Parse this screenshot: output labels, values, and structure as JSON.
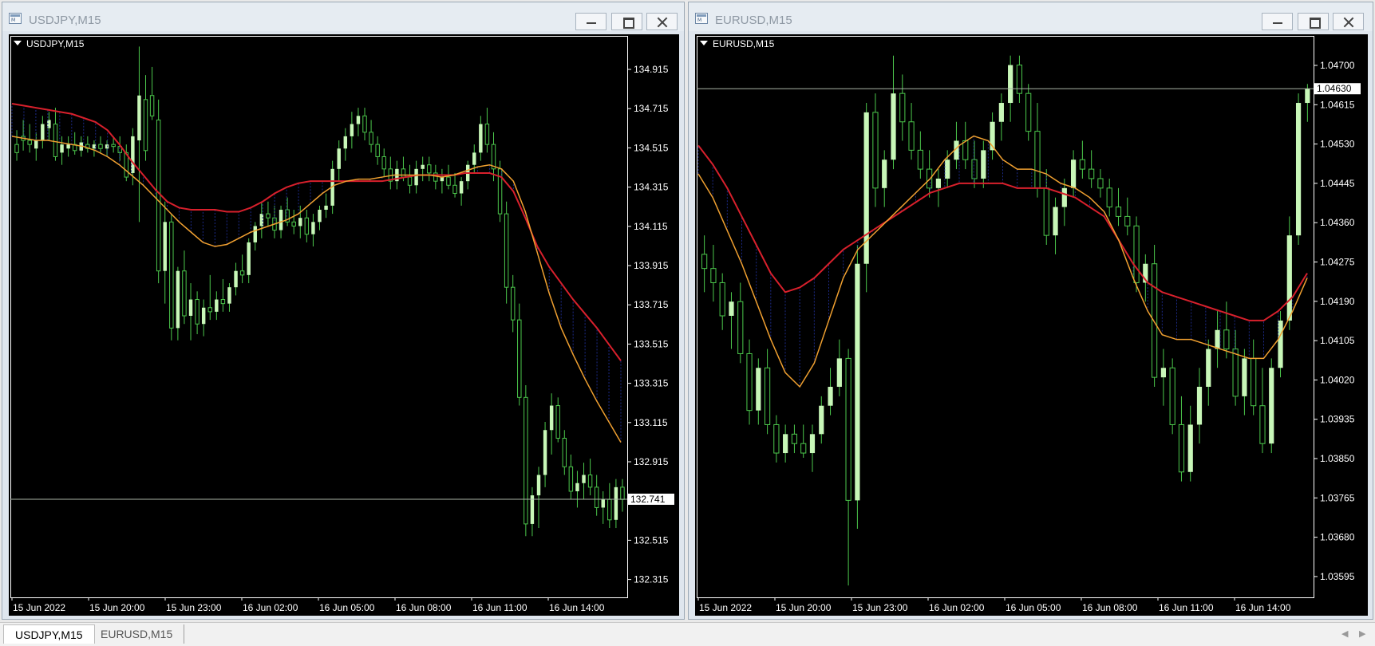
{
  "windows": [
    {
      "title": "USDJPY,M15",
      "symbol_label": "USDJPY,M15",
      "price_labels": [
        "134.915",
        "134.715",
        "134.515",
        "134.315",
        "134.115",
        "133.915",
        "133.715",
        "133.515",
        "133.315",
        "133.115",
        "132.915",
        "132.715",
        "132.515",
        "132.315"
      ],
      "current_price": "132.741",
      "time_labels": [
        "15 Jun 2022",
        "15 Jun 20:00",
        "15 Jun 23:00",
        "16 Jun 02:00",
        "16 Jun 05:00",
        "16 Jun 08:00",
        "16 Jun 11:00",
        "16 Jun 14:00"
      ],
      "price_min": 132.26,
      "price_max": 135.02,
      "line_price": 132.741,
      "candles": [
        [
          134.48,
          134.55,
          134.4,
          134.44
        ],
        [
          134.52,
          134.6,
          134.45,
          134.5
        ],
        [
          134.5,
          134.58,
          134.44,
          134.48
        ],
        [
          134.46,
          134.54,
          134.4,
          134.5
        ],
        [
          134.5,
          134.62,
          134.46,
          134.58
        ],
        [
          134.56,
          134.64,
          134.5,
          134.6
        ],
        [
          134.58,
          134.66,
          134.4,
          134.42
        ],
        [
          134.44,
          134.52,
          134.38,
          134.48
        ],
        [
          134.46,
          134.52,
          134.42,
          134.48
        ],
        [
          134.48,
          134.54,
          134.43,
          134.45
        ],
        [
          134.45,
          134.52,
          134.42,
          134.49
        ],
        [
          134.48,
          134.52,
          134.44,
          134.46
        ],
        [
          134.46,
          134.5,
          134.42,
          134.48
        ],
        [
          134.48,
          134.52,
          134.44,
          134.46
        ],
        [
          134.46,
          134.5,
          134.42,
          134.48
        ],
        [
          134.48,
          134.52,
          134.44,
          134.47
        ],
        [
          134.47,
          134.52,
          134.4,
          134.44
        ],
        [
          134.44,
          134.48,
          134.3,
          134.32
        ],
        [
          134.34,
          134.56,
          134.28,
          134.52
        ],
        [
          134.5,
          134.96,
          134.1,
          134.72
        ],
        [
          134.7,
          134.82,
          134.4,
          134.45
        ],
        [
          134.72,
          134.86,
          134.6,
          134.62
        ],
        [
          134.6,
          134.7,
          133.8,
          133.86
        ],
        [
          133.86,
          134.2,
          133.7,
          134.1
        ],
        [
          134.1,
          134.14,
          133.52,
          133.58
        ],
        [
          133.58,
          133.88,
          133.52,
          133.86
        ],
        [
          133.86,
          133.96,
          133.6,
          133.64
        ],
        [
          133.64,
          133.8,
          133.52,
          133.72
        ],
        [
          133.72,
          133.76,
          133.55,
          133.6
        ],
        [
          133.6,
          133.72,
          133.54,
          133.68
        ],
        [
          133.68,
          133.84,
          133.62,
          133.66
        ],
        [
          133.66,
          133.76,
          133.62,
          133.72
        ],
        [
          133.72,
          133.82,
          133.66,
          133.7
        ],
        [
          133.7,
          133.8,
          133.66,
          133.78
        ],
        [
          133.78,
          133.9,
          133.74,
          133.86
        ],
        [
          133.86,
          133.94,
          133.8,
          133.84
        ],
        [
          133.84,
          134.02,
          133.8,
          134.0
        ],
        [
          134.0,
          134.1,
          133.96,
          134.08
        ],
        [
          134.08,
          134.2,
          134.02,
          134.14
        ],
        [
          134.14,
          134.2,
          134.08,
          134.12
        ],
        [
          134.12,
          134.18,
          134.02,
          134.06
        ],
        [
          134.06,
          134.18,
          134.02,
          134.16
        ],
        [
          134.16,
          134.22,
          134.08,
          134.1
        ],
        [
          134.1,
          134.16,
          134.04,
          134.08
        ],
        [
          134.08,
          134.18,
          134.02,
          134.12
        ],
        [
          134.12,
          134.16,
          134.0,
          134.04
        ],
        [
          134.04,
          134.14,
          133.98,
          134.1
        ],
        [
          134.1,
          134.18,
          134.06,
          134.16
        ],
        [
          134.16,
          134.24,
          134.12,
          134.18
        ],
        [
          134.18,
          134.4,
          134.14,
          134.36
        ],
        [
          134.36,
          134.5,
          134.3,
          134.46
        ],
        [
          134.46,
          134.56,
          134.4,
          134.52
        ],
        [
          134.52,
          134.64,
          134.46,
          134.58
        ],
        [
          134.58,
          134.66,
          134.52,
          134.62
        ],
        [
          134.62,
          134.66,
          134.5,
          134.54
        ],
        [
          134.54,
          134.6,
          134.44,
          134.48
        ],
        [
          134.48,
          134.52,
          134.38,
          134.42
        ],
        [
          134.42,
          134.46,
          134.32,
          134.36
        ],
        [
          134.36,
          134.42,
          134.26,
          134.3
        ],
        [
          134.3,
          134.4,
          134.26,
          134.36
        ],
        [
          134.36,
          134.42,
          134.3,
          134.32
        ],
        [
          134.32,
          134.38,
          134.24,
          134.28
        ],
        [
          134.28,
          134.4,
          134.24,
          134.36
        ],
        [
          134.36,
          134.42,
          134.3,
          134.38
        ],
        [
          134.38,
          134.42,
          134.3,
          134.34
        ],
        [
          134.34,
          134.38,
          134.26,
          134.3
        ],
        [
          134.3,
          134.36,
          134.24,
          134.32
        ],
        [
          134.32,
          134.38,
          134.26,
          134.28
        ],
        [
          134.28,
          134.34,
          134.22,
          134.24
        ],
        [
          134.24,
          134.32,
          134.18,
          134.3
        ],
        [
          134.3,
          134.4,
          134.26,
          134.38
        ],
        [
          134.38,
          134.48,
          134.34,
          134.44
        ],
        [
          134.44,
          134.62,
          134.4,
          134.58
        ],
        [
          134.58,
          134.66,
          134.44,
          134.48
        ],
        [
          134.48,
          134.54,
          134.3,
          134.36
        ],
        [
          134.36,
          134.4,
          134.1,
          134.14
        ],
        [
          134.14,
          134.2,
          133.7,
          133.78
        ],
        [
          133.78,
          133.84,
          133.56,
          133.62
        ],
        [
          133.62,
          133.7,
          133.2,
          133.24
        ],
        [
          133.24,
          133.3,
          132.56,
          132.62
        ],
        [
          132.62,
          132.8,
          132.56,
          132.76
        ],
        [
          132.76,
          132.9,
          132.6,
          132.86
        ],
        [
          132.86,
          133.12,
          132.8,
          133.08
        ],
        [
          133.08,
          133.26,
          132.96,
          133.2
        ],
        [
          133.2,
          133.24,
          133.02,
          133.04
        ],
        [
          133.04,
          133.08,
          132.86,
          132.9
        ],
        [
          132.9,
          132.96,
          132.74,
          132.78
        ],
        [
          132.78,
          132.88,
          132.7,
          132.82
        ],
        [
          132.82,
          132.92,
          132.74,
          132.86
        ],
        [
          132.86,
          132.94,
          132.76,
          132.8
        ],
        [
          132.8,
          132.86,
          132.66,
          132.7
        ],
        [
          132.7,
          132.78,
          132.62,
          132.74
        ],
        [
          132.74,
          132.82,
          132.6,
          132.64
        ],
        [
          132.64,
          132.84,
          132.6,
          132.8
        ],
        [
          132.8,
          132.84,
          132.68,
          132.74
        ]
      ],
      "ma_fast": [
        134.52,
        134.51,
        134.5,
        134.5,
        134.49,
        134.48,
        134.47,
        134.45,
        134.42,
        134.38,
        134.33,
        134.28,
        134.22,
        134.16,
        134.1,
        134.05,
        134.0,
        133.98,
        133.99,
        134.02,
        134.05,
        134.07,
        134.09,
        134.11,
        134.14,
        134.19,
        134.24,
        134.28,
        134.3,
        134.31,
        134.31,
        134.32,
        134.33,
        134.33,
        134.33,
        134.33,
        134.32,
        134.33,
        134.35,
        134.37,
        134.38,
        134.36,
        134.3,
        134.15,
        133.95,
        133.75,
        133.58,
        133.45,
        133.33,
        133.22,
        133.12,
        133.02
      ],
      "ma_slow": [
        134.68,
        134.67,
        134.66,
        134.65,
        134.64,
        134.63,
        134.61,
        134.59,
        134.55,
        134.48,
        134.4,
        134.33,
        134.26,
        134.2,
        134.17,
        134.16,
        134.16,
        134.16,
        134.15,
        134.15,
        134.17,
        134.2,
        134.24,
        134.27,
        134.29,
        134.3,
        134.3,
        134.3,
        134.3,
        134.3,
        134.3,
        134.3,
        134.31,
        134.32,
        134.33,
        134.33,
        134.33,
        134.33,
        134.34,
        134.34,
        134.34,
        134.32,
        134.25,
        134.12,
        133.98,
        133.88,
        133.8,
        133.72,
        133.65,
        133.58,
        133.5,
        133.42
      ]
    },
    {
      "title": "EURUSD,M15",
      "symbol_label": "EURUSD,M15",
      "price_labels": [
        "1.04700",
        "1.04615",
        "1.04530",
        "1.04445",
        "1.04360",
        "1.04275",
        "1.04190",
        "1.04105",
        "1.04020",
        "1.03935",
        "1.03850",
        "1.03765",
        "1.03680",
        "1.03595"
      ],
      "current_price": "1.04630",
      "time_labels": [
        "15 Jun 2022",
        "15 Jun 20:00",
        "15 Jun 23:00",
        "16 Jun 02:00",
        "16 Jun 05:00",
        "16 Jun 08:00",
        "16 Jun 11:00",
        "16 Jun 14:00"
      ],
      "price_min": 1.03555,
      "price_max": 1.04745,
      "line_price": 1.0463,
      "candles": [
        [
          1.0428,
          1.0432,
          1.042,
          1.0425
        ],
        [
          1.0425,
          1.043,
          1.0418,
          1.0422
        ],
        [
          1.0422,
          1.0424,
          1.0412,
          1.0415
        ],
        [
          1.0415,
          1.042,
          1.0408,
          1.0418
        ],
        [
          1.0418,
          1.0422,
          1.0405,
          1.0407
        ],
        [
          1.0407,
          1.041,
          1.0392,
          1.0395
        ],
        [
          1.0395,
          1.0406,
          1.0392,
          1.0404
        ],
        [
          1.0404,
          1.0408,
          1.039,
          1.0392
        ],
        [
          1.0392,
          1.0394,
          1.0384,
          1.0386
        ],
        [
          1.0386,
          1.0392,
          1.0384,
          1.039
        ],
        [
          1.039,
          1.0392,
          1.0386,
          1.0388
        ],
        [
          1.0388,
          1.0392,
          1.0385,
          1.0386
        ],
        [
          1.0386,
          1.0392,
          1.0382,
          1.039
        ],
        [
          1.039,
          1.0398,
          1.0388,
          1.0396
        ],
        [
          1.0396,
          1.0404,
          1.0394,
          1.04
        ],
        [
          1.04,
          1.041,
          1.0398,
          1.0406
        ],
        [
          1.0406,
          1.0408,
          1.0358,
          1.0376
        ],
        [
          1.0376,
          1.043,
          1.037,
          1.0426
        ],
        [
          1.0426,
          1.046,
          1.042,
          1.0458
        ],
        [
          1.0458,
          1.0462,
          1.0438,
          1.0442
        ],
        [
          1.0442,
          1.045,
          1.0438,
          1.0448
        ],
        [
          1.0448,
          1.047,
          1.0446,
          1.0462
        ],
        [
          1.0462,
          1.0466,
          1.0452,
          1.0456
        ],
        [
          1.0456,
          1.046,
          1.0448,
          1.045
        ],
        [
          1.045,
          1.0454,
          1.0444,
          1.0446
        ],
        [
          1.0446,
          1.045,
          1.044,
          1.0442
        ],
        [
          1.0442,
          1.0446,
          1.0438,
          1.0444
        ],
        [
          1.0444,
          1.045,
          1.0442,
          1.0448
        ],
        [
          1.0448,
          1.0456,
          1.0446,
          1.0452
        ],
        [
          1.0452,
          1.0456,
          1.0446,
          1.0448
        ],
        [
          1.0448,
          1.0452,
          1.0442,
          1.0444
        ],
        [
          1.0444,
          1.0452,
          1.0442,
          1.045
        ],
        [
          1.045,
          1.0458,
          1.0448,
          1.0456
        ],
        [
          1.0456,
          1.0462,
          1.0452,
          1.046
        ],
        [
          1.046,
          1.047,
          1.0456,
          1.0468
        ],
        [
          1.0468,
          1.047,
          1.046,
          1.0462
        ],
        [
          1.0462,
          1.0464,
          1.0452,
          1.0454
        ],
        [
          1.0454,
          1.046,
          1.044,
          1.0442
        ],
        [
          1.0442,
          1.0446,
          1.043,
          1.0432
        ],
        [
          1.0432,
          1.044,
          1.0428,
          1.0438
        ],
        [
          1.0438,
          1.0444,
          1.0434,
          1.0442
        ],
        [
          1.0442,
          1.045,
          1.044,
          1.0448
        ],
        [
          1.0448,
          1.0452,
          1.0444,
          1.0446
        ],
        [
          1.0446,
          1.045,
          1.0442,
          1.0444
        ],
        [
          1.0444,
          1.0446,
          1.044,
          1.0442
        ],
        [
          1.0442,
          1.0444,
          1.0436,
          1.0438
        ],
        [
          1.0438,
          1.0442,
          1.0434,
          1.0436
        ],
        [
          1.0436,
          1.044,
          1.0432,
          1.0434
        ],
        [
          1.0434,
          1.0436,
          1.042,
          1.0422
        ],
        [
          1.0422,
          1.0428,
          1.0418,
          1.0426
        ],
        [
          1.0426,
          1.043,
          1.04,
          1.0402
        ],
        [
          1.0402,
          1.0408,
          1.0396,
          1.0404
        ],
        [
          1.0404,
          1.0406,
          1.039,
          1.0392
        ],
        [
          1.0392,
          1.0398,
          1.038,
          1.0382
        ],
        [
          1.0382,
          1.0396,
          1.038,
          1.0392
        ],
        [
          1.0392,
          1.0404,
          1.0388,
          1.04
        ],
        [
          1.04,
          1.041,
          1.0396,
          1.0408
        ],
        [
          1.0408,
          1.0416,
          1.0404,
          1.0412
        ],
        [
          1.0412,
          1.0418,
          1.0406,
          1.0408
        ],
        [
          1.0408,
          1.0412,
          1.0396,
          1.0398
        ],
        [
          1.0398,
          1.0408,
          1.0394,
          1.0406
        ],
        [
          1.0406,
          1.041,
          1.0394,
          1.0396
        ],
        [
          1.0396,
          1.0404,
          1.0386,
          1.0388
        ],
        [
          1.0388,
          1.0406,
          1.0386,
          1.0404
        ],
        [
          1.0404,
          1.0416,
          1.0402,
          1.0414
        ],
        [
          1.0414,
          1.0436,
          1.0412,
          1.0432
        ],
        [
          1.0432,
          1.0462,
          1.043,
          1.046
        ],
        [
          1.046,
          1.0464,
          1.0456,
          1.0463
        ]
      ],
      "ma_fast": [
        1.0445,
        1.044,
        1.0433,
        1.0426,
        1.0418,
        1.041,
        1.0403,
        1.04,
        1.0405,
        1.0414,
        1.0423,
        1.0429,
        1.0432,
        1.0435,
        1.0438,
        1.0441,
        1.0444,
        1.0448,
        1.0451,
        1.0453,
        1.0452,
        1.0448,
        1.0446,
        1.0446,
        1.0445,
        1.0443,
        1.0442,
        1.044,
        1.0437,
        1.0431,
        1.0423,
        1.0416,
        1.0411,
        1.041,
        1.041,
        1.0409,
        1.0408,
        1.0407,
        1.0406,
        1.0406,
        1.041,
        1.0416,
        1.0423
      ],
      "ma_slow": [
        1.0451,
        1.0447,
        1.0442,
        1.0436,
        1.043,
        1.0424,
        1.042,
        1.0421,
        1.0423,
        1.0426,
        1.0429,
        1.0431,
        1.0433,
        1.0435,
        1.0437,
        1.0439,
        1.0441,
        1.0442,
        1.0443,
        1.0443,
        1.0443,
        1.0443,
        1.0442,
        1.0442,
        1.0442,
        1.0441,
        1.044,
        1.0438,
        1.0436,
        1.0431,
        1.0426,
        1.0422,
        1.042,
        1.0419,
        1.0418,
        1.0417,
        1.0416,
        1.0415,
        1.0414,
        1.0414,
        1.0416,
        1.0419,
        1.0424
      ]
    }
  ],
  "tabs": [
    {
      "label": "USDJPY,M15",
      "active": true
    },
    {
      "label": "EURUSD,M15",
      "active": false
    }
  ],
  "colors": {
    "background": "#000000",
    "candle_bull": "#c8f7b8",
    "wick": "#4cc84c",
    "ma_fast": "#f0a030",
    "ma_slow": "#d8202c",
    "band_fill": "#1c2a88",
    "axis": "#ffffff",
    "price_line": "#aab4a6"
  }
}
